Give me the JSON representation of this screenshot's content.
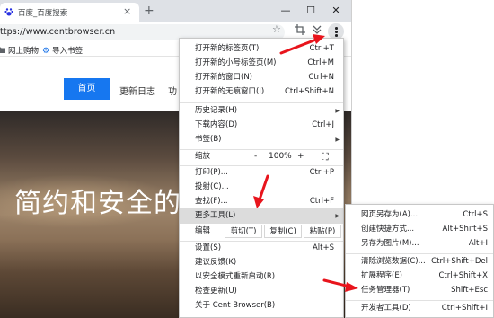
{
  "tab": {
    "title": "百度_百度搜索",
    "close": "×",
    "newtab": "+"
  },
  "window": {
    "minimize": "—",
    "maximize": "☐",
    "close": "✕"
  },
  "address": {
    "url": "ttps://www.centbrowser.cn"
  },
  "bookmarks": [
    {
      "label": "网上购物",
      "icon": "folder-icon"
    },
    {
      "label": "导入书签",
      "icon": "gear-icon"
    }
  ],
  "site": {
    "nav": {
      "home": "首页",
      "changelog": "更新日志",
      "more": "功"
    },
    "hero_text": "简约和安全的浏"
  },
  "menu": {
    "items": [
      {
        "label": "打开新的标签页(T)",
        "shortcut": "Ctrl+T"
      },
      {
        "label": "打开新的小号标签页(M)",
        "shortcut": "Ctrl+M"
      },
      {
        "label": "打开新的窗口(N)",
        "shortcut": "Ctrl+N"
      },
      {
        "label": "打开新的无痕窗口(I)",
        "shortcut": "Ctrl+Shift+N"
      },
      {
        "label": "历史记录(H)",
        "shortcut": ""
      },
      {
        "label": "下载内容(D)",
        "shortcut": "Ctrl+J"
      },
      {
        "label": "书签(B)",
        "shortcut": ""
      },
      {
        "label": "打印(P)...",
        "shortcut": "Ctrl+P"
      },
      {
        "label": "投射(C)...",
        "shortcut": ""
      },
      {
        "label": "查找(F)...",
        "shortcut": "Ctrl+F"
      },
      {
        "label": "更多工具(L)",
        "shortcut": ""
      },
      {
        "label": "设置(S)",
        "shortcut": "Alt+S"
      },
      {
        "label": "建议反馈(K)",
        "shortcut": ""
      },
      {
        "label": "以安全模式重新启动(R)",
        "shortcut": ""
      },
      {
        "label": "检查更新(U)",
        "shortcut": ""
      },
      {
        "label": "关于 Cent Browser(B)",
        "shortcut": ""
      }
    ],
    "zoom": {
      "label": "缩放",
      "minus": "-",
      "value": "100%",
      "plus": "+",
      "fullscreen": "⛶"
    },
    "edit": {
      "label": "编辑",
      "cut": "剪切(T)",
      "copy": "复制(C)",
      "paste": "粘贴(P)"
    }
  },
  "submenu": {
    "items": [
      {
        "label": "网页另存为(A)...",
        "shortcut": "Ctrl+S"
      },
      {
        "label": "创建快捷方式...",
        "shortcut": "Alt+Shift+S"
      },
      {
        "label": "另存为图片(M)...",
        "shortcut": "Alt+I"
      },
      {
        "label": "清除浏览数据(C)...",
        "shortcut": "Ctrl+Shift+Del"
      },
      {
        "label": "扩展程序(E)",
        "shortcut": "Ctrl+Shift+X"
      },
      {
        "label": "任务管理器(T)",
        "shortcut": "Shift+Esc"
      },
      {
        "label": "开发者工具(D)",
        "shortcut": "Ctrl+Shift+I"
      }
    ]
  },
  "colors": {
    "accent": "#1677f0",
    "arrow": "#e8141c",
    "highlight": "#dcdcdc"
  }
}
